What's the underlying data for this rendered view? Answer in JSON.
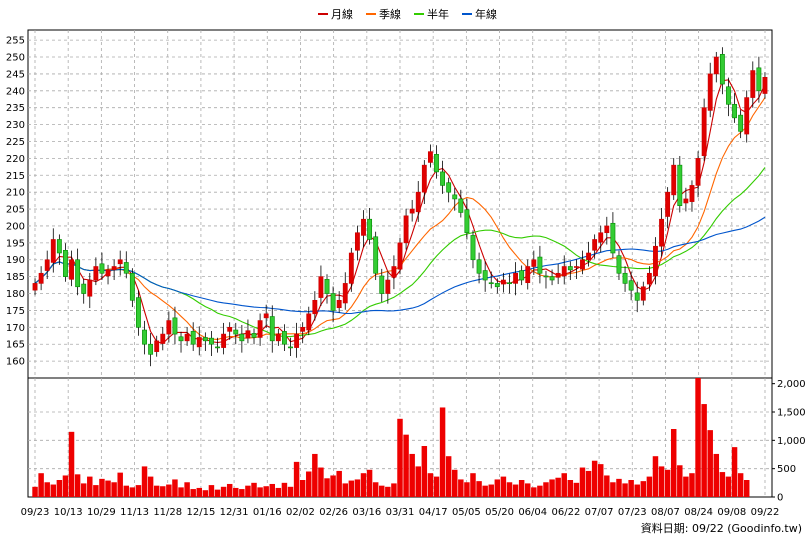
{
  "chart_data": {
    "type": "candlestick+volume",
    "legend": [
      {
        "label": "月線",
        "color": "#cc0000"
      },
      {
        "label": "季線",
        "color": "#ff6600"
      },
      {
        "label": "半年",
        "color": "#33cc00"
      },
      {
        "label": "年線",
        "color": "#0055cc"
      }
    ],
    "price_axis": {
      "ticks": [
        "255",
        "250",
        "245",
        "240",
        "235",
        "230",
        "225",
        "220",
        "215",
        "210",
        "205",
        "200",
        "195",
        "190",
        "185",
        "180",
        "175",
        "170",
        "165",
        "160"
      ],
      "min": 155,
      "max": 258
    },
    "volume_axis": {
      "ticks": [
        "2,000",
        "1,500",
        "1,000",
        "500",
        "0"
      ],
      "min": 0,
      "max": 2100
    },
    "x_labels": [
      "09/23",
      "10/13",
      "10/29",
      "11/13",
      "11/28",
      "12/15",
      "12/31",
      "01/16",
      "02/02",
      "02/26",
      "03/16",
      "03/31",
      "04/17",
      "05/05",
      "05/20",
      "06/04",
      "06/22",
      "07/07",
      "07/23",
      "08/07",
      "08/24",
      "09/08",
      "09/22"
    ],
    "close_series": [
      183,
      186,
      190,
      196,
      192,
      185,
      190,
      182,
      180,
      184,
      188,
      186,
      187,
      188,
      190,
      186,
      178,
      170,
      165,
      162,
      166,
      168,
      172,
      168,
      166,
      168,
      165,
      167,
      166,
      165,
      164,
      168,
      170,
      168,
      166,
      169,
      167,
      172,
      174,
      166,
      168,
      165,
      164,
      168,
      170,
      174,
      178,
      185,
      180,
      175,
      178,
      183,
      192,
      198,
      202,
      196,
      186,
      180,
      184,
      188,
      195,
      203,
      205,
      210,
      218,
      222,
      216,
      212,
      210,
      208,
      204,
      198,
      190,
      186,
      184,
      183,
      182,
      184,
      183,
      186,
      184,
      188,
      190,
      186,
      185,
      184,
      186,
      188,
      187,
      188,
      190,
      192,
      196,
      198,
      200,
      192,
      186,
      183,
      181,
      178,
      182,
      186,
      194,
      202,
      210,
      218,
      206,
      208,
      212,
      220,
      235,
      245,
      250,
      242,
      236,
      232,
      228,
      238,
      246,
      240,
      244
    ],
    "volume_series": [
      180,
      420,
      260,
      220,
      300,
      380,
      1150,
      400,
      240,
      360,
      210,
      320,
      290,
      260,
      430,
      200,
      170,
      210,
      540,
      360,
      200,
      190,
      220,
      310,
      170,
      260,
      140,
      160,
      120,
      210,
      130,
      180,
      230,
      160,
      140,
      200,
      250,
      170,
      190,
      230,
      160,
      250,
      180,
      620,
      300,
      450,
      760,
      520,
      330,
      380,
      460,
      240,
      290,
      310,
      420,
      480,
      260,
      200,
      180,
      240,
      1380,
      1100,
      760,
      540,
      900,
      420,
      360,
      1580,
      720,
      480,
      310,
      260,
      420,
      280,
      200,
      220,
      310,
      360,
      260,
      220,
      300,
      240,
      170,
      200,
      260,
      310,
      340,
      420,
      300,
      250,
      520,
      460,
      640,
      580,
      380,
      260,
      320,
      240,
      300,
      220,
      280,
      360,
      720,
      540,
      480,
      1200,
      560,
      360,
      420,
      2100,
      1640,
      1180,
      760,
      440,
      360,
      880,
      420,
      300
    ]
  },
  "source_label": "資料日期: 09/22 (Goodinfo.tw)"
}
